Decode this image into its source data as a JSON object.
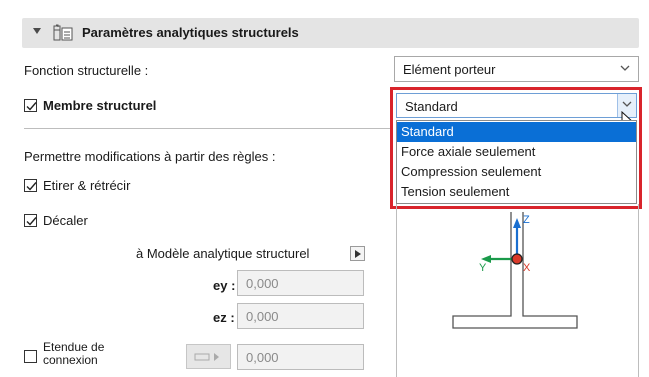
{
  "section": {
    "title": "Paramètres analytiques structurels",
    "icon": "structural-settings-icon"
  },
  "structural_function": {
    "label": "Fonction structurelle :",
    "value": "Elément porteur"
  },
  "structural_member": {
    "label": "Membre structurel",
    "checked": true,
    "value": "Standard",
    "options": [
      "Standard",
      "Force axiale seulement",
      "Compression seulement",
      "Tension seulement"
    ],
    "selected_index": 0
  },
  "rules": {
    "heading": "Permettre modifications à partir des règles :",
    "stretch_label": "Etirer & rétrécir",
    "stretch_checked": true,
    "offset_label": "Décaler",
    "offset_checked": true
  },
  "analytical_model": {
    "label": "à Modèle analytique structurel",
    "ey_label": "ey :",
    "ey_value": "0,000",
    "ez_label": "ez :",
    "ez_value": "0,000"
  },
  "connection_extent": {
    "label_line1": "Etendue de",
    "label_line2": "connexion",
    "checked": false,
    "value": "0,000"
  },
  "preview": {
    "axis_z": "Z",
    "axis_y": "Y",
    "axis_x": "X"
  },
  "colors": {
    "accent": "#0a6fd6",
    "highlight": "#d9242b",
    "axis_z": "#1a6fd0",
    "axis_y": "#1a9a4a",
    "axis_x": "#d93a2a"
  }
}
